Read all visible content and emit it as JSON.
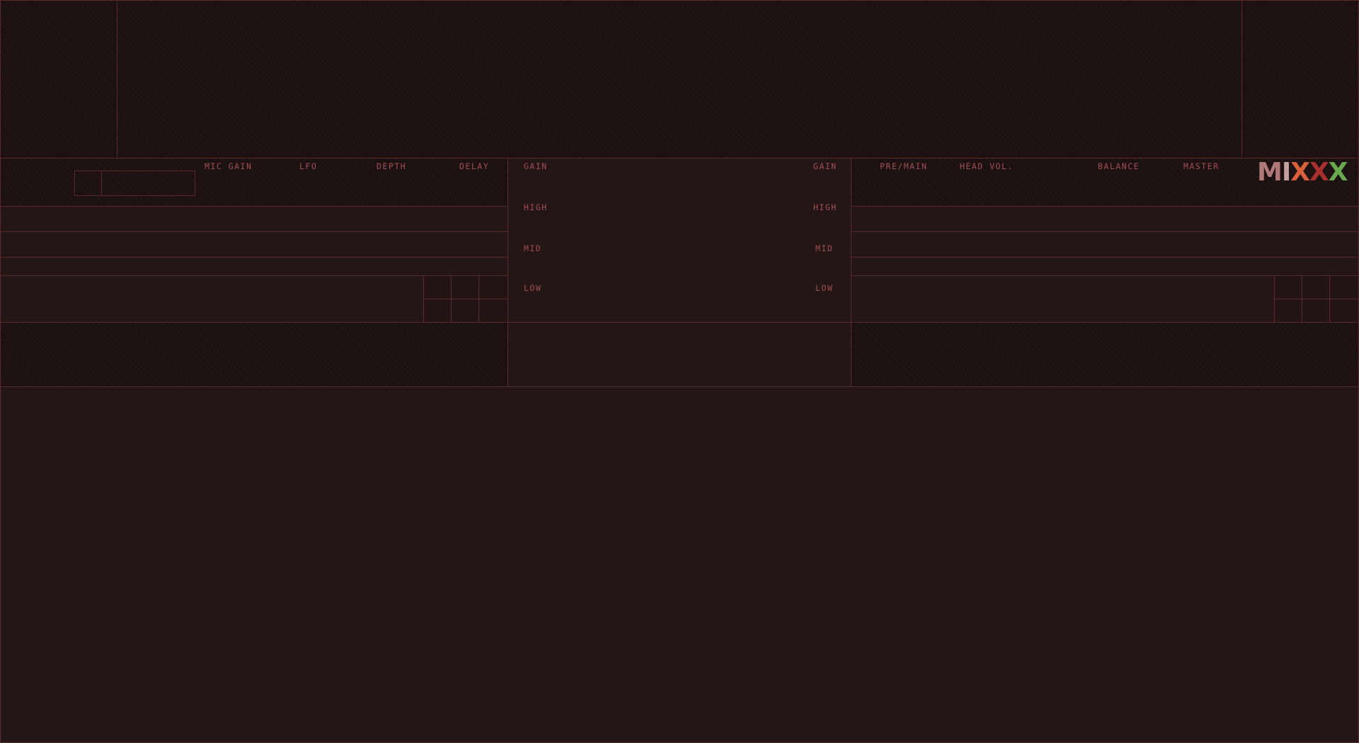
{
  "deck1": {
    "fx_labels": [
      "MIC GAIN",
      "LFO",
      "DEPTH",
      "DELAY"
    ]
  },
  "mixer": {
    "left_eq": {
      "gain": "GAIN",
      "high": "HIGH",
      "mid": "MID",
      "low": "LOW"
    },
    "right_eq": {
      "gain": "GAIN",
      "high": "HIGH",
      "mid": "MID",
      "low": "LOW"
    }
  },
  "deck2": {
    "labels": [
      "PRE/MAIN",
      "HEAD VOL.",
      "BALANCE",
      "MASTER"
    ]
  },
  "logo": {
    "text": "MIXXX",
    "colors": {
      "m": "#b07878",
      "i": "#c4a0a0",
      "x1": "#d8613a",
      "x2": "#a8302d",
      "x3": "#6aa84f"
    }
  },
  "theme": {
    "background": "#231414",
    "border": "#5a2a2e",
    "label": "#a34f55"
  }
}
